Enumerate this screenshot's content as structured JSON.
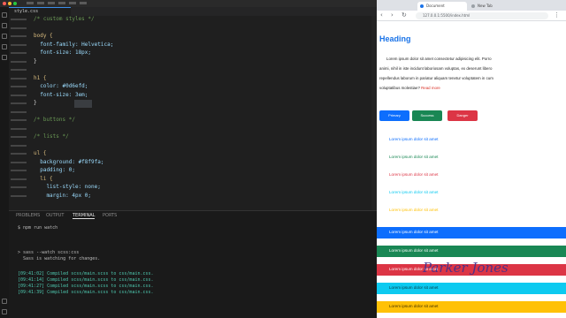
{
  "editor": {
    "tab_label": "style.css",
    "code_lines": [
      {
        "text": "/* custom styles */",
        "color": "#6a9955"
      },
      {
        "text": "",
        "color": "#cccccc"
      },
      {
        "text": "body {",
        "color": "#d7ba7d"
      },
      {
        "text": "  font-family: Helvetica;",
        "color": "#9cdcfe"
      },
      {
        "text": "  font-size: 18px;",
        "color": "#9cdcfe"
      },
      {
        "text": "}",
        "color": "#d4d4d4"
      },
      {
        "text": "",
        "color": "#cccccc"
      },
      {
        "text": "h1 {",
        "color": "#d7ba7d"
      },
      {
        "text": "  color: #0d6efd;",
        "color": "#9cdcfe"
      },
      {
        "text": "  font-size: 3em;",
        "color": "#9cdcfe"
      },
      {
        "text": "}",
        "color": "#d4d4d4"
      },
      {
        "text": "",
        "color": "#cccccc"
      },
      {
        "text": "/* buttons */",
        "color": "#6a9955"
      },
      {
        "text": "",
        "color": "#cccccc"
      },
      {
        "text": "/* lists */",
        "color": "#6a9955"
      },
      {
        "text": "",
        "color": "#cccccc"
      },
      {
        "text": "ul {",
        "color": "#d7ba7d"
      },
      {
        "text": "  background: #f8f9fa;",
        "color": "#9cdcfe"
      },
      {
        "text": "  padding: 0;",
        "color": "#9cdcfe"
      },
      {
        "text": "  li {",
        "color": "#d7ba7d"
      },
      {
        "text": "    list-style: none;",
        "color": "#9cdcfe"
      },
      {
        "text": "    margin: 4px 0;",
        "color": "#9cdcfe"
      }
    ]
  },
  "panel": {
    "tabs": [
      "PROBLEMS",
      "OUTPUT",
      "TERMINAL",
      "PORTS"
    ],
    "active_tab": "TERMINAL",
    "terminal_lines": [
      {
        "text": "$ npm run watch",
        "color": "#bbbbbb"
      },
      {
        "text": "",
        "color": "#bbbbbb"
      },
      {
        "text": "> sass --watch scss:css",
        "color": "#bbbbbb"
      },
      {
        "text": "  Sass is watching for changes.",
        "color": "#bbbbbb"
      },
      {
        "text": "",
        "color": "#bbbbbb"
      },
      {
        "text": "[09:41:02] Compiled scss/main.scss to css/main.css.",
        "color": "#4ec9b0"
      },
      {
        "text": "[09:41:14] Compiled scss/main.scss to css/main.css.",
        "color": "#4ec9b0"
      },
      {
        "text": "[09:41:27] Compiled scss/main.scss to css/main.css.",
        "color": "#4ec9b0"
      },
      {
        "text": "[09:41:39] Compiled scss/main.scss to css/main.css.",
        "color": "#4ec9b0"
      }
    ]
  },
  "browser": {
    "tab_active": "Document",
    "tab_other": "New Tab",
    "url": "127.0.0.1:5500/index.html",
    "heading": "Heading",
    "paragraph_lines": [
      "Lorem ipsum dolor sit amet consectetur adipisicing elit. Porro",
      "animi, nihil in iste incidunt laboriosam voluptas, ex deserunt libero",
      "repellendus laborum in pariatur aliquam tenetur voluptatem in cum",
      "voluptatibus molestiae?"
    ],
    "paragraph_link": "Read more",
    "buttons": [
      {
        "label": "Primary",
        "color": "#0d6efd"
      },
      {
        "label": "Success",
        "color": "#198754"
      },
      {
        "label": "Danger",
        "color": "#dc3545"
      }
    ],
    "plain_items": [
      {
        "text": "Lorem ipsum dolor sit amet",
        "color": "#0d6efd"
      },
      {
        "text": "Lorem ipsum dolor sit amet",
        "color": "#198754"
      },
      {
        "text": "Lorem ipsum dolor sit amet",
        "color": "#dc3545"
      },
      {
        "text": "Lorem ipsum dolor sit amet",
        "color": "#0dcaf0"
      },
      {
        "text": "Lorem ipsum dolor sit amet",
        "color": "#ffc107"
      }
    ],
    "band_items": [
      {
        "text": "Lorem ipsum dolor sit amet",
        "bg": "#0d6efd",
        "color": "#ffffff"
      },
      {
        "text": "Lorem ipsum dolor sit amet",
        "bg": "#198754",
        "color": "#ffffff"
      },
      {
        "text": "Lorem ipsum dolor sit amet",
        "bg": "#dc3545",
        "color": "#ffffff"
      },
      {
        "text": "Lorem ipsum dolor sit amet",
        "bg": "#0dcaf0",
        "color": "#0b3a45"
      },
      {
        "text": "Lorem ipsum dolor sit amet",
        "bg": "#ffc107",
        "color": "#3d2e00"
      }
    ],
    "signature": "Parker Jones"
  }
}
